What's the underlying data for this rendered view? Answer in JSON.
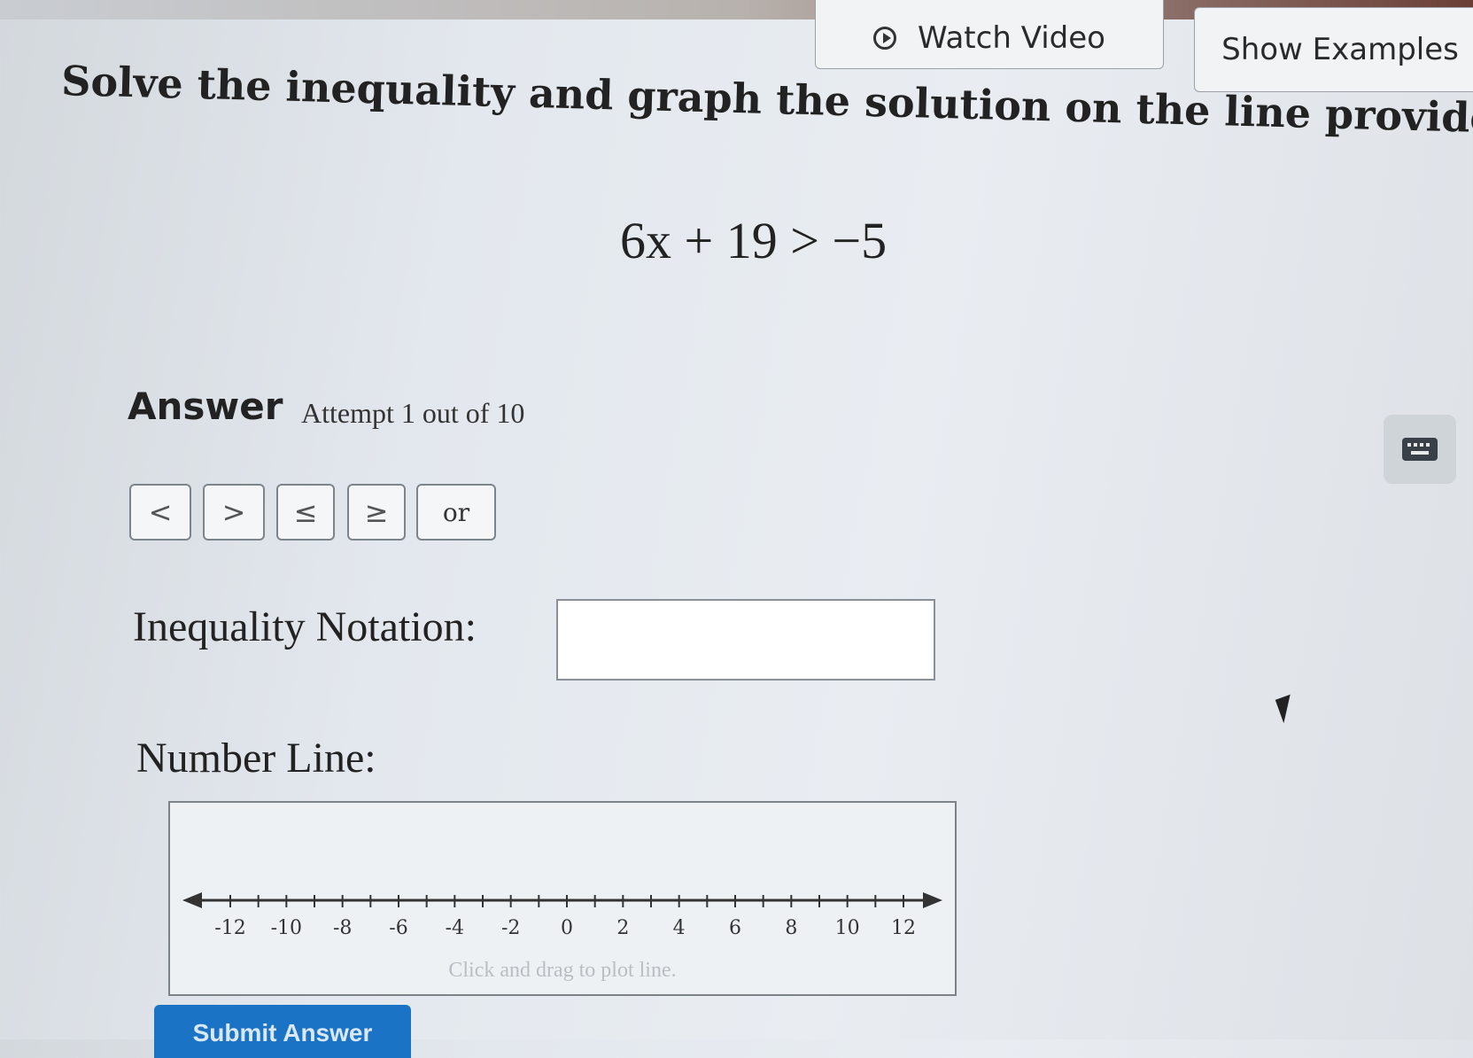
{
  "header": {
    "watch_video_label": "Watch Video",
    "show_examples_label": "Show Examples"
  },
  "problem": {
    "prompt": "Solve the inequality and graph the solution on the line provided.",
    "equation": "6x + 19 > −5"
  },
  "answer": {
    "label": "Answer",
    "attempt": "Attempt 1 out of 10"
  },
  "symbol_buttons": {
    "lt": "<",
    "gt": ">",
    "le": "≤",
    "ge": "≥",
    "or": "or"
  },
  "inequality": {
    "label": "Inequality Notation:",
    "value": ""
  },
  "number_line": {
    "label": "Number Line:",
    "tick_labels": [
      "-12",
      "-10",
      "-8",
      "-6",
      "-4",
      "-2",
      "0",
      "2",
      "4",
      "6",
      "8",
      "10",
      "12"
    ],
    "hint": "Click and drag to plot line."
  },
  "submit": {
    "label": "Submit Answer"
  }
}
